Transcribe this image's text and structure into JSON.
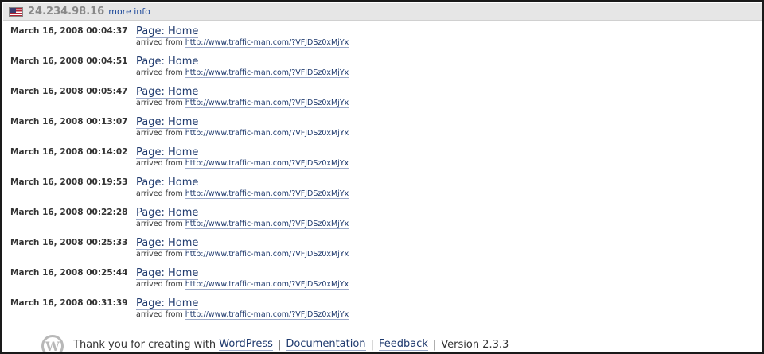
{
  "visitor": {
    "flag_icon": "us-flag-icon",
    "ip": "24.234.98.16",
    "more_info_label": "more info"
  },
  "hits": [
    {
      "time": "March 16, 2008 00:04:37",
      "page": "Page: Home",
      "arrived_label": "arrived from",
      "referrer": "http://www.traffic-man.com/?VFJDSz0xMjYx"
    },
    {
      "time": "March 16, 2008 00:04:51",
      "page": "Page: Home",
      "arrived_label": "arrived from",
      "referrer": "http://www.traffic-man.com/?VFJDSz0xMjYx"
    },
    {
      "time": "March 16, 2008 00:05:47",
      "page": "Page: Home",
      "arrived_label": "arrived from",
      "referrer": "http://www.traffic-man.com/?VFJDSz0xMjYx"
    },
    {
      "time": "March 16, 2008 00:13:07",
      "page": "Page: Home",
      "arrived_label": "arrived from",
      "referrer": "http://www.traffic-man.com/?VFJDSz0xMjYx"
    },
    {
      "time": "March 16, 2008 00:14:02",
      "page": "Page: Home",
      "arrived_label": "arrived from",
      "referrer": "http://www.traffic-man.com/?VFJDSz0xMjYx"
    },
    {
      "time": "March 16, 2008 00:19:53",
      "page": "Page: Home",
      "arrived_label": "arrived from",
      "referrer": "http://www.traffic-man.com/?VFJDSz0xMjYx"
    },
    {
      "time": "March 16, 2008 00:22:28",
      "page": "Page: Home",
      "arrived_label": "arrived from",
      "referrer": "http://www.traffic-man.com/?VFJDSz0xMjYx"
    },
    {
      "time": "March 16, 2008 00:25:33",
      "page": "Page: Home",
      "arrived_label": "arrived from",
      "referrer": "http://www.traffic-man.com/?VFJDSz0xMjYx"
    },
    {
      "time": "March 16, 2008 00:25:44",
      "page": "Page: Home",
      "arrived_label": "arrived from",
      "referrer": "http://www.traffic-man.com/?VFJDSz0xMjYx"
    },
    {
      "time": "March 16, 2008 00:31:39",
      "page": "Page: Home",
      "arrived_label": "arrived from",
      "referrer": "http://www.traffic-man.com/?VFJDSz0xMjYx"
    }
  ],
  "footer": {
    "logo_icon": "wordpress-logo-icon",
    "thanks_text": "Thank you for creating with",
    "wordpress_link": "WordPress",
    "documentation_link": "Documentation",
    "feedback_link": "Feedback",
    "version_text": "Version 2.3.3",
    "separator": "|"
  },
  "colors": {
    "link": "#1f3a6e",
    "header_bg": "#e6e6e6",
    "ip_text": "#888888",
    "border": "#1a1a1a"
  }
}
